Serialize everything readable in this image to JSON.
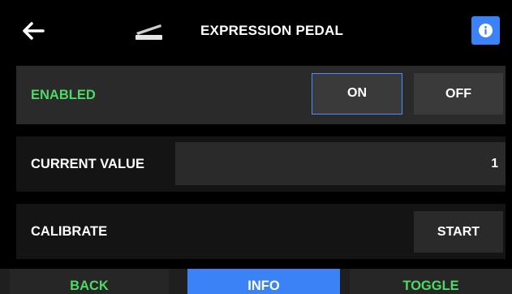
{
  "header": {
    "title": "EXPRESSION PEDAL",
    "back_icon": "arrow-left-icon",
    "pedal_icon": "expression-pedal-icon",
    "info_icon": "info-icon"
  },
  "rows": {
    "enabled": {
      "label": "ENABLED",
      "on_label": "ON",
      "off_label": "OFF",
      "selected": "ON"
    },
    "current_value": {
      "label": "CURRENT VALUE",
      "value": "1"
    },
    "calibrate": {
      "label": "CALIBRATE",
      "start_label": "START"
    }
  },
  "footer": {
    "back_label": "BACK",
    "info_label": "INFO",
    "toggle_label": "TOGGLE"
  },
  "colors": {
    "accent_blue": "#3b82f6",
    "enabled_green": "#4cd964",
    "row_active_bg": "#2a2a2a",
    "row_bg": "#141414"
  }
}
